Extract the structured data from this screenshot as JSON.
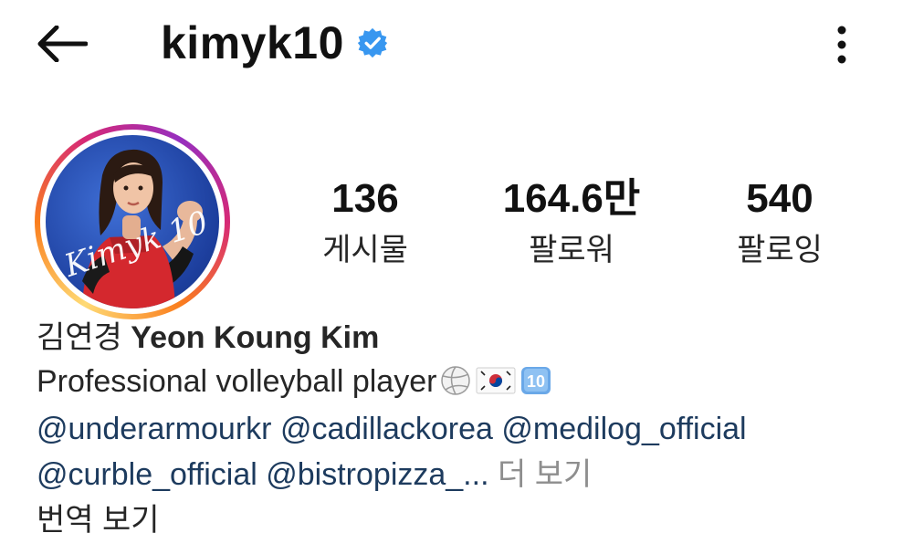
{
  "header": {
    "username": "kimyk10",
    "back_icon": "arrow-left-icon",
    "verified_icon": "verified-badge-icon",
    "more_icon": "vertical-dots-icon",
    "verified_color": "#3897f0"
  },
  "profile": {
    "avatar_icon": "profile-photo",
    "avatar_signature": "Kimyk 10",
    "stats": [
      {
        "value": "136",
        "label": "게시물"
      },
      {
        "value": "164.6만",
        "label": "팔로워"
      },
      {
        "value": "540",
        "label": "팔로잉"
      }
    ]
  },
  "bio": {
    "korean_name": "김연경",
    "english_name": "Yeon Koung Kim",
    "description": "Professional volleyball player",
    "emojis": [
      "volleyball-emoji",
      "south-korea-flag-emoji",
      "keycap-ten-emoji"
    ],
    "emoji_ten_text": "10",
    "mentions_line1": [
      "@underarmourkr",
      "@cadillackorea",
      "@medilog_official"
    ],
    "mentions_line2": [
      "@curble_official",
      "@bistropizza_..."
    ],
    "more_label": "더 보기",
    "translate_label": "번역 보기"
  },
  "colors": {
    "link": "#1d3b5e",
    "muted": "#8e8e8e",
    "text": "#262626"
  }
}
